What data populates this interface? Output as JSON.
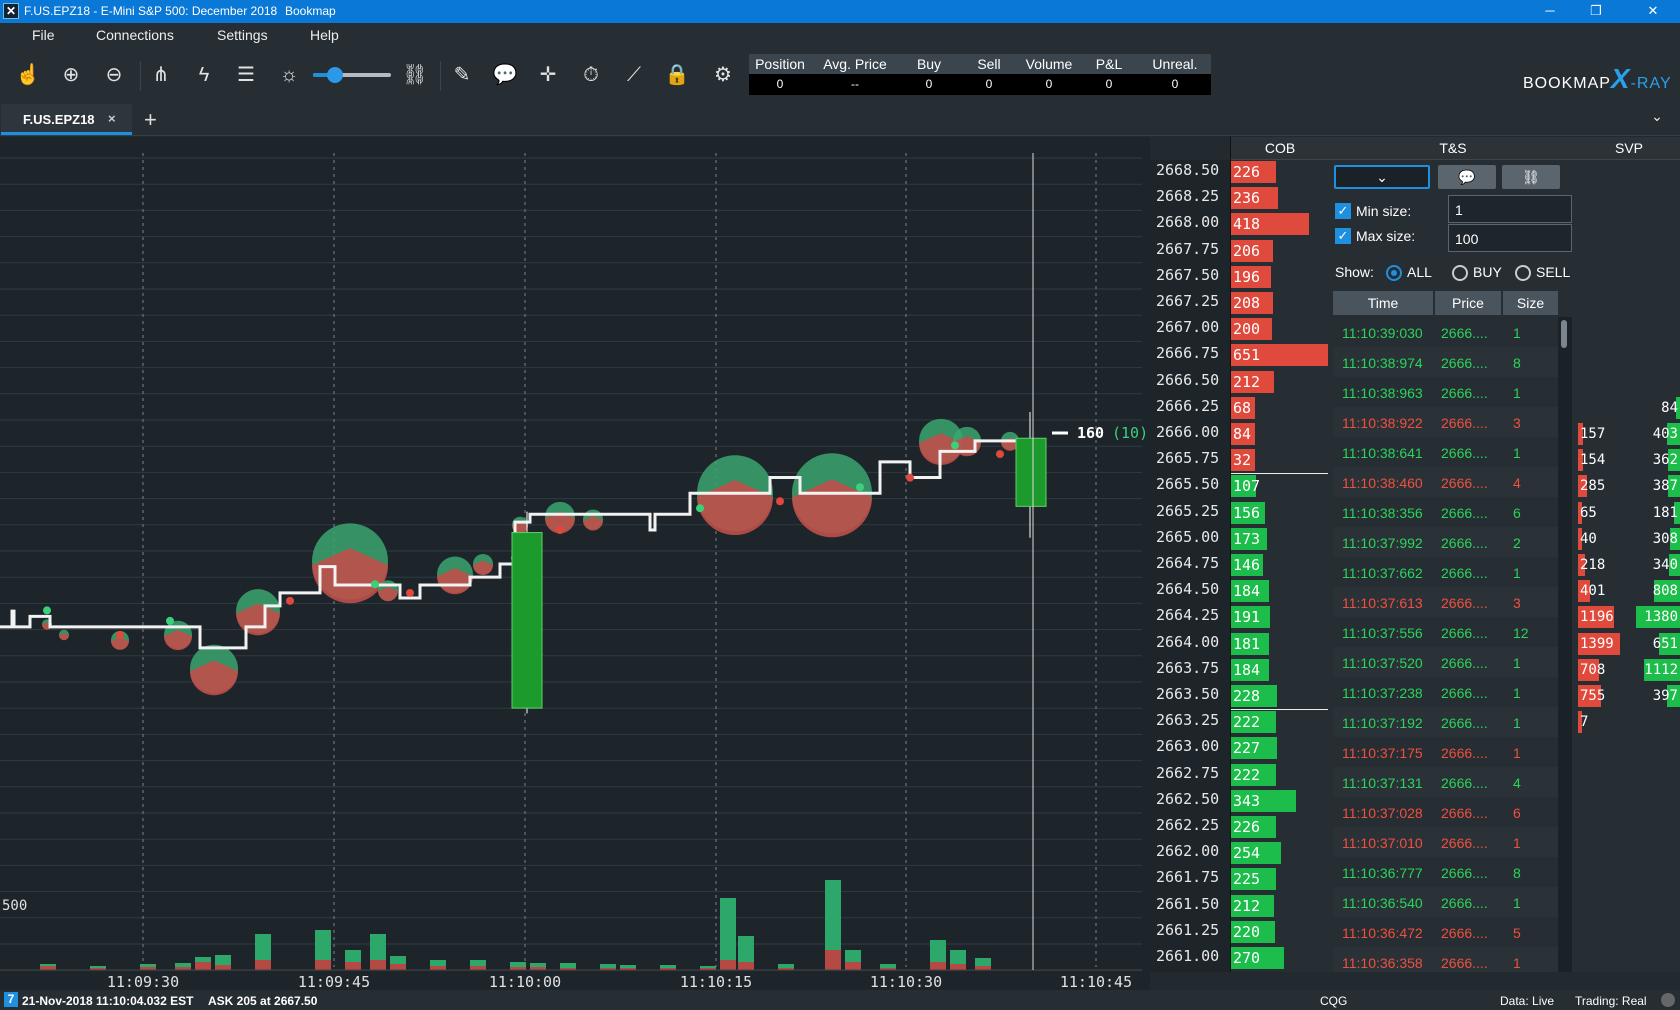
{
  "window": {
    "title": "F.US.EPZ18 - E-Mini S&P 500: December 2018",
    "app": "Bookmap"
  },
  "menu": [
    "File",
    "Connections",
    "Settings",
    "Help"
  ],
  "toolbar": {
    "zoom_fraction": 0.28
  },
  "stats": {
    "headers": [
      "Position",
      "Avg. Price",
      "Buy",
      "Sell",
      "Volume",
      "P&L",
      "Unreal. P&L"
    ],
    "values": [
      "0",
      "--",
      "0",
      "0",
      "0",
      "0",
      "0"
    ]
  },
  "brand": {
    "name": "BOOKMAP",
    "x": "X",
    "ray": "-RAY"
  },
  "tab": {
    "label": "F.US.EPZ18",
    "close": "×",
    "add": "+"
  },
  "panels": {
    "cob": "COB",
    "ts": "T&S",
    "svp": "SVP"
  },
  "prices": [
    "2668.50",
    "2668.25",
    "2668.00",
    "2667.75",
    "2667.50",
    "2667.25",
    "2667.00",
    "2666.75",
    "2666.50",
    "2666.25",
    "2666.00",
    "2665.75",
    "2665.50",
    "2665.25",
    "2665.00",
    "2664.75",
    "2664.50",
    "2664.25",
    "2664.00",
    "2663.75",
    "2663.50",
    "2663.25",
    "2663.00",
    "2662.75",
    "2662.50",
    "2662.25",
    "2662.00",
    "2661.75",
    "2661.50",
    "2661.25",
    "2661.00"
  ],
  "cob": {
    "ask": [
      226,
      236,
      418,
      206,
      196,
      208,
      200,
      651,
      212,
      68,
      84,
      32
    ],
    "bid": [
      107,
      156,
      173,
      146,
      184,
      191,
      181,
      184,
      228,
      222,
      227,
      222,
      343,
      226,
      254,
      225,
      212,
      220,
      270
    ],
    "ask_color": "#e04a3c",
    "bid_color": "#1cbd4b"
  },
  "chart": {
    "last_price_label": "160",
    "last_price_count": "(10)",
    "volume_scale_label": "500",
    "time_labels": [
      "11:09:30",
      "11:09:45",
      "11:10:00",
      "11:10:15",
      "11:10:30",
      "11:10:45"
    ]
  },
  "ts": {
    "min_size_label": "Min size:",
    "max_size_label": "Max size:",
    "min_size": "1",
    "max_size": "100",
    "show_label": "Show:",
    "options": [
      "ALL",
      "BUY",
      "SELL"
    ],
    "selected": "ALL",
    "columns": [
      "Time",
      "Price",
      "Size"
    ],
    "rows": [
      {
        "time": "11:10:39:030",
        "price": "2666....",
        "size": "1",
        "side": "buy"
      },
      {
        "time": "11:10:38:974",
        "price": "2666....",
        "size": "8",
        "side": "buy"
      },
      {
        "time": "11:10:38:963",
        "price": "2666....",
        "size": "1",
        "side": "buy"
      },
      {
        "time": "11:10:38:922",
        "price": "2666....",
        "size": "3",
        "side": "sell"
      },
      {
        "time": "11:10:38:641",
        "price": "2666....",
        "size": "1",
        "side": "buy"
      },
      {
        "time": "11:10:38:460",
        "price": "2666....",
        "size": "4",
        "side": "sell"
      },
      {
        "time": "11:10:38:356",
        "price": "2666....",
        "size": "6",
        "side": "buy"
      },
      {
        "time": "11:10:37:992",
        "price": "2666....",
        "size": "2",
        "side": "buy"
      },
      {
        "time": "11:10:37:662",
        "price": "2666....",
        "size": "1",
        "side": "buy"
      },
      {
        "time": "11:10:37:613",
        "price": "2666....",
        "size": "3",
        "side": "sell"
      },
      {
        "time": "11:10:37:556",
        "price": "2666....",
        "size": "12",
        "side": "buy"
      },
      {
        "time": "11:10:37:520",
        "price": "2666....",
        "size": "1",
        "side": "buy"
      },
      {
        "time": "11:10:37:238",
        "price": "2666....",
        "size": "1",
        "side": "buy"
      },
      {
        "time": "11:10:37:192",
        "price": "2666....",
        "size": "1",
        "side": "buy"
      },
      {
        "time": "11:10:37:175",
        "price": "2666....",
        "size": "1",
        "side": "sell"
      },
      {
        "time": "11:10:37:131",
        "price": "2666....",
        "size": "4",
        "side": "buy"
      },
      {
        "time": "11:10:37:028",
        "price": "2666....",
        "size": "6",
        "side": "sell"
      },
      {
        "time": "11:10:37:010",
        "price": "2666....",
        "size": "1",
        "side": "sell"
      },
      {
        "time": "11:10:36:777",
        "price": "2666....",
        "size": "8",
        "side": "buy"
      },
      {
        "time": "11:10:36:540",
        "price": "2666....",
        "size": "1",
        "side": "buy"
      },
      {
        "time": "11:10:36:472",
        "price": "2666....",
        "size": "5",
        "side": "sell"
      },
      {
        "time": "11:10:36:358",
        "price": "2666....",
        "size": "1",
        "side": "sell"
      }
    ]
  },
  "svp": {
    "rows": [
      {
        "price": "2666.25",
        "sell": "",
        "buy": "84"
      },
      {
        "price": "2666.00",
        "sell": "157",
        "buy": "403"
      },
      {
        "price": "2665.75",
        "sell": "154",
        "buy": "362"
      },
      {
        "price": "2665.50",
        "sell": "285",
        "buy": "387"
      },
      {
        "price": "2665.25",
        "sell": "65",
        "buy": "181"
      },
      {
        "price": "2665.00",
        "sell": "40",
        "buy": "308"
      },
      {
        "price": "2664.75",
        "sell": "218",
        "buy": "340"
      },
      {
        "price": "2664.50",
        "sell": "401",
        "buy": "808"
      },
      {
        "price": "2664.25",
        "sell": "1196",
        "buy": "1380"
      },
      {
        "price": "2664.00",
        "sell": "1399",
        "buy": "651"
      },
      {
        "price": "2663.75",
        "sell": "708",
        "buy": "1112"
      },
      {
        "price": "2663.50",
        "sell": "755",
        "buy": "397"
      },
      {
        "price": "2663.25",
        "sell": "7",
        "buy": ""
      }
    ]
  },
  "status": {
    "datetime": "21-Nov-2018 11:10:04.032 EST",
    "ask": "ASK 205 at 2667.50",
    "provider": "CQG",
    "data": "Data: Live",
    "trading": "Trading: Real"
  }
}
